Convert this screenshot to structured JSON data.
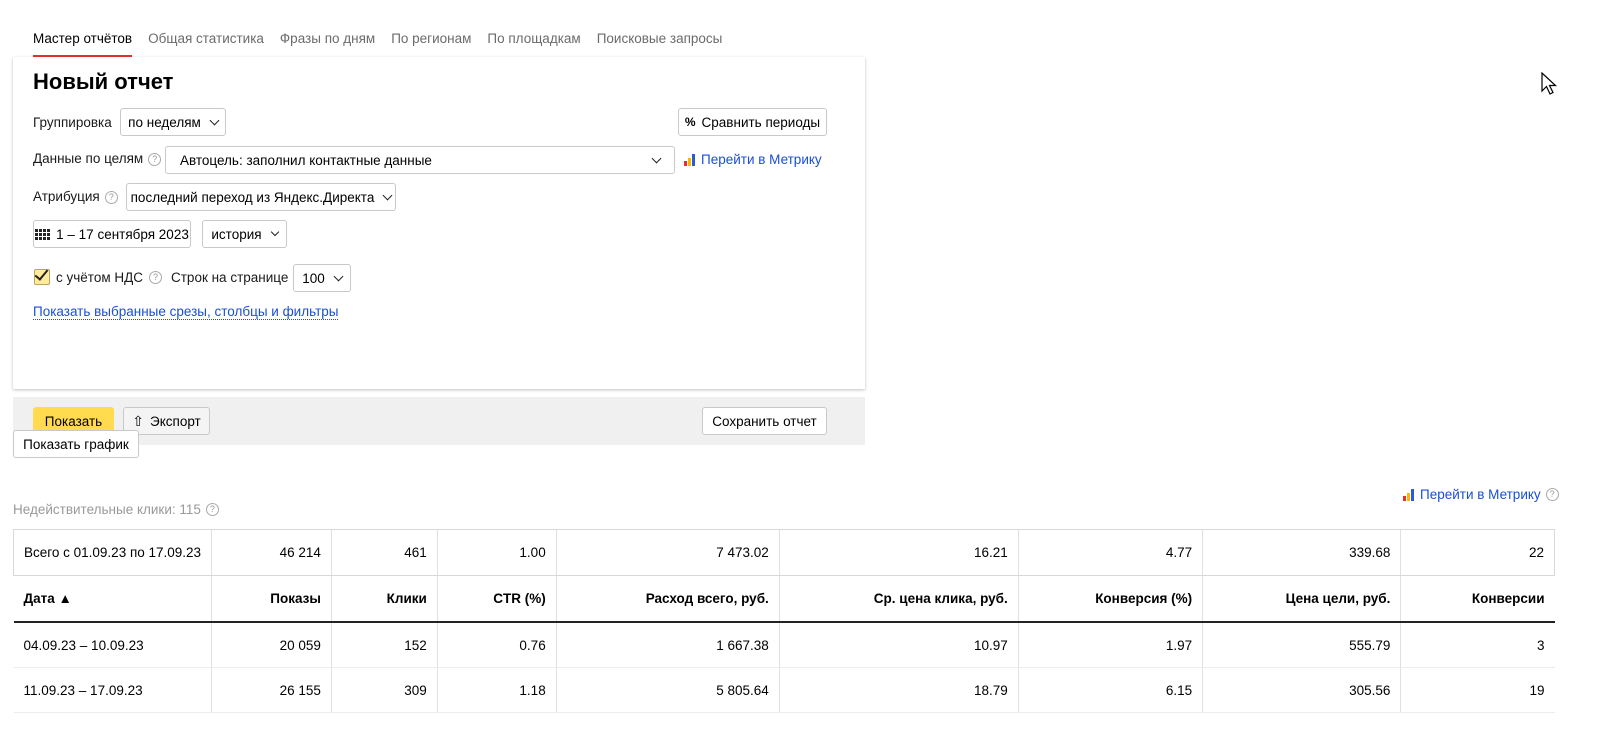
{
  "tabs": [
    {
      "label": "Мастер отчётов"
    },
    {
      "label": "Общая статистика"
    },
    {
      "label": "Фразы по дням"
    },
    {
      "label": "По регионам"
    },
    {
      "label": "По площадкам"
    },
    {
      "label": "Поисковые запросы"
    }
  ],
  "panel": {
    "title": "Новый отчет",
    "grouping_label": "Группировка",
    "grouping_value": "по неделям",
    "compare_label": "Сравнить периоды",
    "goals_label": "Данные по целям",
    "goals_value": "Автоцель: заполнил контактные данные",
    "metrica_link": "Перейти в Метрику",
    "attribution_label": "Атрибуция",
    "attribution_value": "последний переход из Яндекс.Директа",
    "date_range": "1 – 17 сентября 2023",
    "history_label": "история",
    "vat_label": "с учётом НДС",
    "rows_label": "Строк на странице",
    "rows_value": "100",
    "show_filters_link": "Показать выбранные срезы, столбцы и фильтры",
    "show_button": "Показать",
    "export_button": "Экспорт",
    "save_button": "Сохранить отчет"
  },
  "chart_button": "Показать график",
  "invalid_clicks": "Недействительные клики: 115",
  "metrica_link_2": "Перейти в Метрику",
  "colors": {
    "accent_yellow": "#ffdb4d",
    "tab_underline": "#e5322d",
    "link": "#1a4ed8"
  },
  "table": {
    "total": [
      "Всего с 01.09.23 по 17.09.23",
      "46 214",
      "461",
      "1.00",
      "7 473.02",
      "16.21",
      "4.77",
      "339.68",
      "22"
    ],
    "headers": [
      "Дата ▲",
      "Показы",
      "Клики",
      "CTR (%)",
      "Расход всего, руб.",
      "Ср. цена клика, руб.",
      "Конверсия (%)",
      "Цена цели, руб.",
      "Конверсии"
    ],
    "rows": [
      [
        "04.09.23 – 10.09.23",
        "20 059",
        "152",
        "0.76",
        "1 667.38",
        "10.97",
        "1.97",
        "555.79",
        "3"
      ],
      [
        "11.09.23 – 17.09.23",
        "26 155",
        "309",
        "1.18",
        "5 805.64",
        "18.79",
        "6.15",
        "305.56",
        "19"
      ]
    ]
  }
}
